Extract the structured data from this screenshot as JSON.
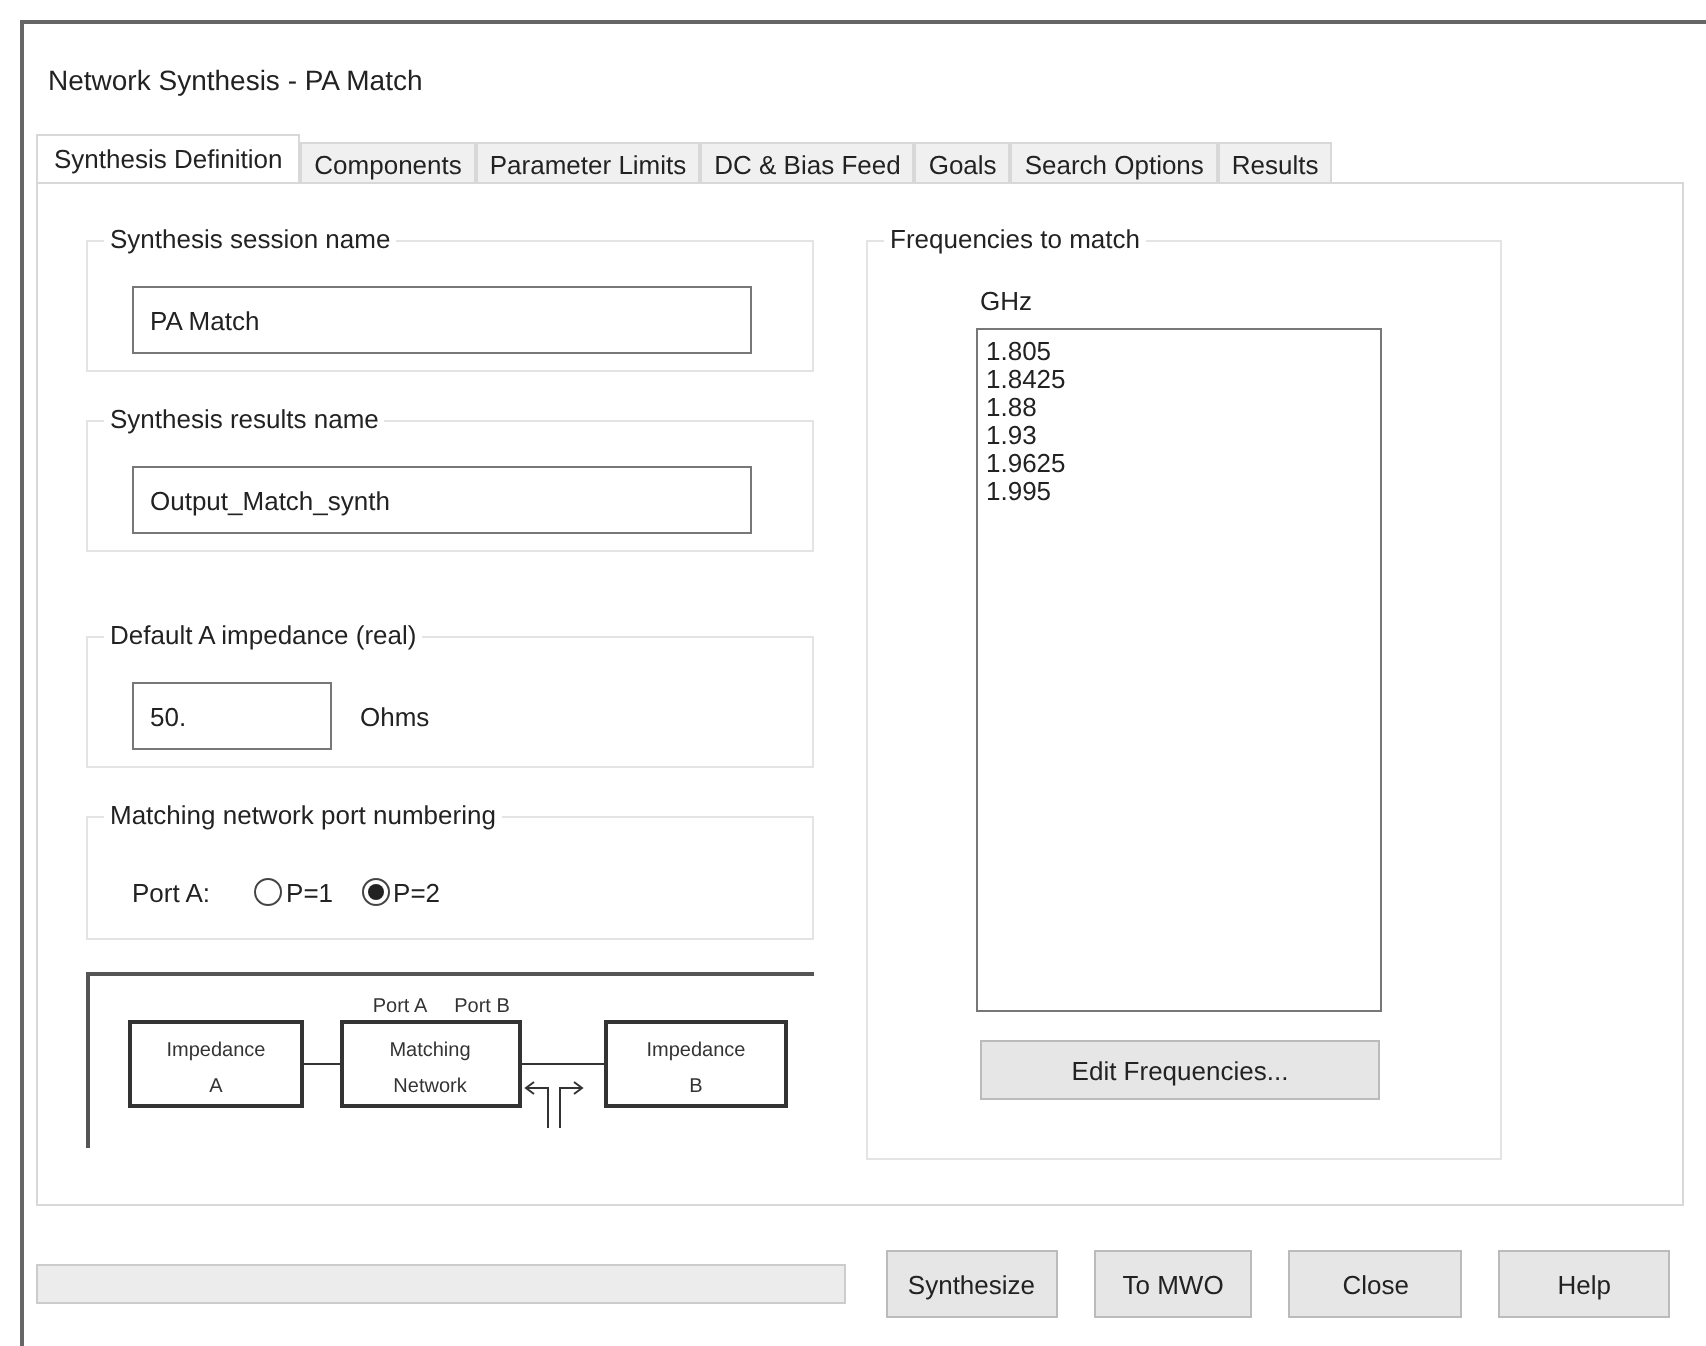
{
  "window": {
    "title": "Network Synthesis - PA Match"
  },
  "tabs": [
    {
      "label": "Synthesis Definition",
      "selected": true
    },
    {
      "label": "Components",
      "selected": false
    },
    {
      "label": "Parameter Limits",
      "selected": false
    },
    {
      "label": "DC & Bias Feed",
      "selected": false
    },
    {
      "label": "Goals",
      "selected": false
    },
    {
      "label": "Search Options",
      "selected": false
    },
    {
      "label": "Results",
      "selected": false
    }
  ],
  "session": {
    "legend": "Synthesis session name",
    "value": "PA Match"
  },
  "results_name": {
    "legend": "Synthesis results name",
    "value": "Output_Match_synth"
  },
  "impedance": {
    "legend": "Default A impedance (real)",
    "value": "50.",
    "unit": "Ohms"
  },
  "port_numbering": {
    "legend": "Matching network port numbering",
    "label": "Port A:",
    "options": [
      {
        "label": "P=1",
        "selected": false
      },
      {
        "label": "P=2",
        "selected": true
      }
    ]
  },
  "diagram": {
    "port_a": "Port A",
    "port_b": "Port B",
    "left_block": [
      "Impedance",
      "A"
    ],
    "middle_block": [
      "Matching",
      "Network"
    ],
    "right_block": [
      "Impedance",
      "B"
    ]
  },
  "frequencies": {
    "legend": "Frequencies to match",
    "unit": "GHz",
    "values": [
      "1.805",
      "1.8425",
      "1.88",
      "1.93",
      "1.9625",
      "1.995"
    ],
    "edit_button": "Edit Frequencies..."
  },
  "progress": {
    "level": 0
  },
  "buttons": [
    "Synthesize",
    "To MWO",
    "Close",
    "Help"
  ]
}
